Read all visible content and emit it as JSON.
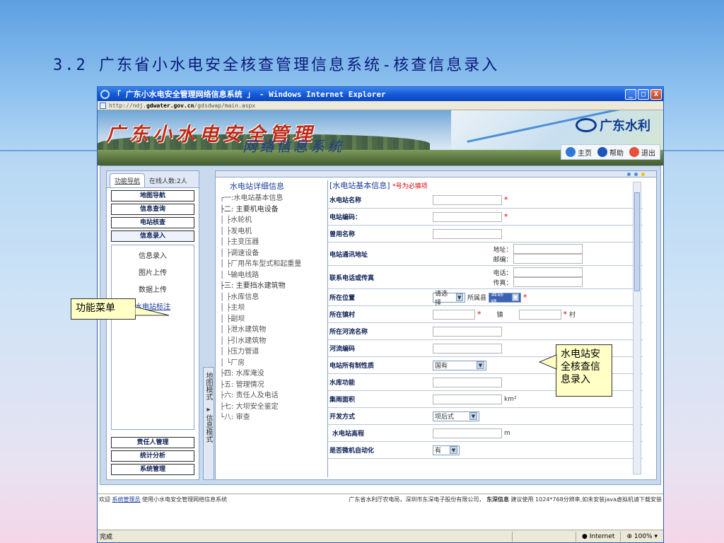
{
  "slide": {
    "title": "3.2 广东省小水电安全核查管理信息系统-核查信息录入"
  },
  "ie": {
    "window_title": "「 广东小水电安全管理网络信息系统 」 - Windows Internet Explorer",
    "url_prefix": "http://ndj.",
    "url_host": "gdwater.gov.cn",
    "url_path": "/gdsdwap/main.aspx",
    "minimize": "_",
    "maximize": "□",
    "close": "X",
    "status_done": "完成",
    "status_zone": "Internet",
    "status_zoom": "100%"
  },
  "banner": {
    "title": "广东小水电安全管理",
    "subtitle": "网络信息系统",
    "brand": "广东水利",
    "links": {
      "home": "主页",
      "help": "帮助",
      "exit": "退出"
    }
  },
  "left_panel": {
    "tab": "功能导航",
    "online": "在线人数:2人",
    "menus": [
      "地图导航",
      "信息查询",
      "电站核查",
      "信息录入"
    ],
    "sub_items": [
      "信息录入",
      "图片上传",
      "数据上传",
      "水电站标注"
    ],
    "bottom_menus": [
      "责任人管理",
      "统计分析",
      "系统管理"
    ],
    "strip_map": "地图模式",
    "strip_info": "信息模式"
  },
  "tree": {
    "title": "水电站详细信息",
    "nodes": [
      "┌一:水电站基本信息",
      "├二: 主要机电设备",
      "│ ├水轮机",
      "│ ├发电机",
      "│ ├主变压器",
      "│ ├调速设备",
      "│ ├厂用吊车型式和起重量",
      "│ └输电线路",
      "├三: 主要挡水建筑物",
      "│ ├水库信息",
      "│ ├主坝",
      "│ ├副坝",
      "│ ├泄水建筑物",
      "│ ├引水建筑物",
      "│ ├压力管道",
      "│ └厂房",
      "├四: 水库淹没",
      "├五: 管理情况",
      "├六: 责任人及电话",
      "├七: 大坝安全鉴定",
      "└八: 审查"
    ]
  },
  "form": {
    "header": "[水电站基本信息]",
    "required_note": "*号为必填项",
    "rows": {
      "station_name": "水电站名称",
      "station_code": "电站编码：",
      "common_name": "曾用名称",
      "contact_address": "电站通讯地址",
      "address_label": "地址：",
      "postcode_label": "邮编：",
      "contact_phone": "联系电话或传真",
      "phone_label": "电话：",
      "fax_label": "传真：",
      "location": "所在位置",
      "location_select": "请选择",
      "county_label": "所属县",
      "county_select": "请选择",
      "town_village": "所在镇村",
      "town_label": "镇",
      "village_label": "村",
      "river_name": "所在河流名称",
      "river_code": "河流编码",
      "ownership": "电站所有制性质",
      "ownership_value": "国有",
      "reservoir_function": "水库功能",
      "catchment_area": "集雨面积",
      "area_unit": "km²",
      "development_mode": "开发方式",
      "development_value": "坝后式",
      "station_height": "水电站高程",
      "height_unit": "m",
      "automation": "是否微机自动化",
      "automation_value": "有"
    },
    "required_mark": "*"
  },
  "footer": {
    "welcome": "欢迎",
    "user": "系统管理员",
    "using": "使用小水电安全管理网络信息系统",
    "credits_pre": "广东省水利厅农电局，深圳市东深电子股份有限公司，",
    "credits_brand": "东深信息",
    "credits_post": "建议使用 1024*768分辨率,如未安装java虚拟机请下载安装"
  },
  "callouts": {
    "menu": "功能菜单",
    "entry": "水电站安全核查信息录入"
  },
  "colors": {
    "accent": "#1458d6",
    "required": "#d40000",
    "title": "#0b1b7a"
  }
}
